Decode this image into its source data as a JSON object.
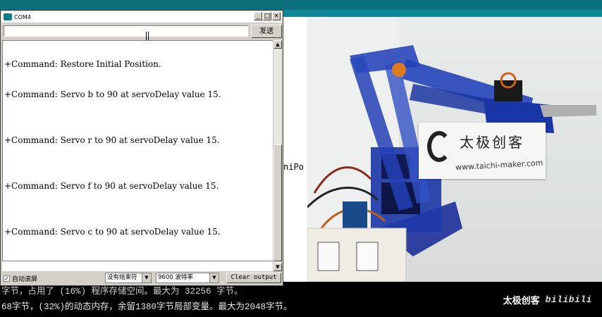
{
  "ide": {
    "editor_fragment": "niPo",
    "console_line1": "字节，占用了 (16%) 程序存储空间。最大为 32256 字节。",
    "console_line2": "68字节，(32%)的动态内存，余留1380字节局部变量。最大为2048字节。"
  },
  "watermark": {
    "text": "太极创客",
    "site": "bilibili"
  },
  "serial_monitor": {
    "title": "COM4",
    "window_buttons": [
      "_",
      "□",
      "×"
    ],
    "input_value": "",
    "send_label": "发送",
    "output_lines": [
      "+Command: Restore Initial Position.",
      "+Command: Servo b to 90 at servoDelay value 15.",
      "+Command: Servo r to 90 at servoDelay value 15.",
      "+Command: Servo f to 90 at servoDelay value 15.",
      "+Command: Servo c to 90 at servoDelay value 15."
    ],
    "autoscroll_label": "自动滚屏",
    "autoscroll_checked": "✓",
    "line_ending": "没有结束符",
    "baud_rate": "9600 波特率",
    "clear_label": "Clear output",
    "scroll_up": "▲",
    "scroll_down": "▼",
    "dropdown_arrow": "▼"
  },
  "photo": {
    "card_brand": "太极创客",
    "card_url": "www.taichi-maker.com"
  },
  "colors": {
    "ide_teal": "#0b6f7c",
    "robot_blue": "#1f3fb0"
  }
}
